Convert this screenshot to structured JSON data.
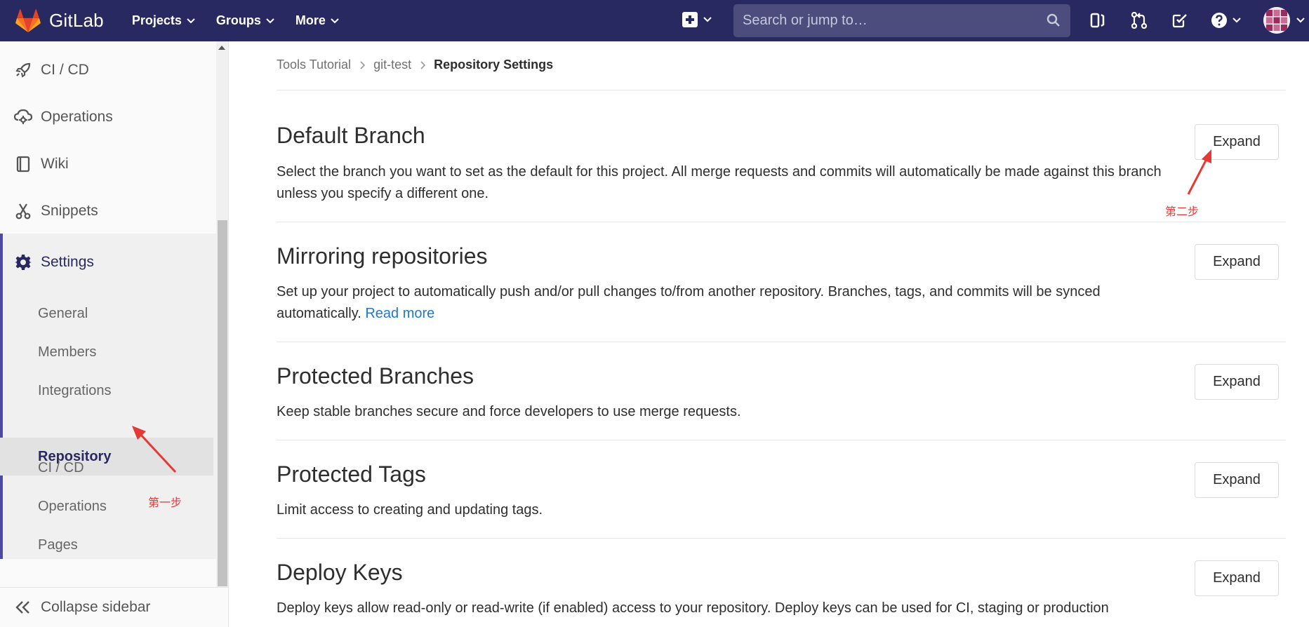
{
  "app": {
    "name": "GitLab"
  },
  "topnav": {
    "links": [
      {
        "label": "Projects"
      },
      {
        "label": "Groups"
      },
      {
        "label": "More"
      }
    ],
    "search_placeholder": "Search or jump to…"
  },
  "sidebar": {
    "items": [
      {
        "label": "CI / CD",
        "icon": "rocket-icon"
      },
      {
        "label": "Operations",
        "icon": "cloud-gear-icon"
      },
      {
        "label": "Wiki",
        "icon": "book-icon"
      },
      {
        "label": "Snippets",
        "icon": "scissors-icon"
      },
      {
        "label": "Settings",
        "icon": "gear-icon"
      }
    ],
    "settings_subitems": [
      {
        "label": "General"
      },
      {
        "label": "Members"
      },
      {
        "label": "Integrations"
      },
      {
        "label": "Repository",
        "active": true
      },
      {
        "label": "CI / CD"
      },
      {
        "label": "Operations"
      },
      {
        "label": "Pages"
      }
    ],
    "collapse_label": "Collapse sidebar"
  },
  "breadcrumb": {
    "items": [
      "Tools Tutorial",
      "git-test"
    ],
    "current": "Repository Settings"
  },
  "sections": [
    {
      "title": "Default Branch",
      "description": "Select the branch you want to set as the default for this project. All merge requests and commits will automatically be made against this branch unless you specify a different one.",
      "button": "Expand"
    },
    {
      "title": "Mirroring repositories",
      "description": "Set up your project to automatically push and/or pull changes to/from another repository. Branches, tags, and commits will be synced automatically.",
      "link": "Read more",
      "button": "Expand"
    },
    {
      "title": "Protected Branches",
      "description": "Keep stable branches secure and force developers to use merge requests.",
      "button": "Expand"
    },
    {
      "title": "Protected Tags",
      "description": "Limit access to creating and updating tags.",
      "button": "Expand"
    },
    {
      "title": "Deploy Keys",
      "description": "Deploy keys allow read-only or read-write (if enabled) access to your repository. Deploy keys can be used for CI, staging or production",
      "button": "Expand"
    }
  ],
  "annotations": {
    "step1": "第一步",
    "step2": "第二步",
    "color": "#e53935"
  },
  "colors": {
    "navbar": "#292961",
    "accent": "#4b4ba3",
    "link": "#1f78d1"
  }
}
